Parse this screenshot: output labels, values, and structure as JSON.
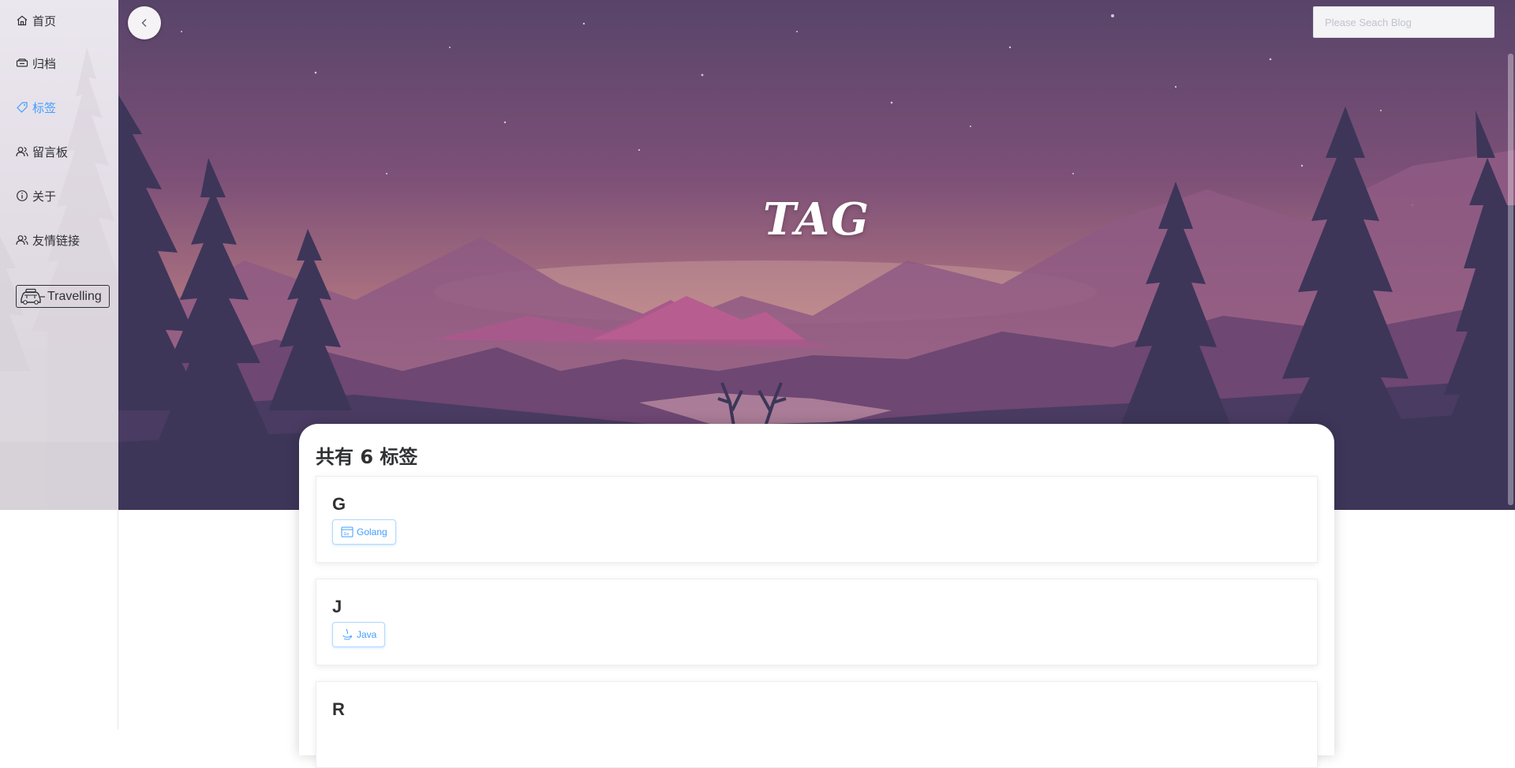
{
  "sidebar": {
    "items": [
      {
        "label": "首页",
        "icon": "home-icon"
      },
      {
        "label": "归档",
        "icon": "archive-icon"
      },
      {
        "label": "标签",
        "icon": "tag-icon",
        "active": true
      },
      {
        "label": "留言板",
        "icon": "users-icon"
      },
      {
        "label": "关于",
        "icon": "info-icon"
      },
      {
        "label": "友情链接",
        "icon": "users-icon"
      }
    ],
    "travel_label": "Travelling"
  },
  "header": {
    "search_placeholder": "Please Seach Blog",
    "hero_title": "TAG"
  },
  "main": {
    "summary": "共有 6 标签",
    "groups": [
      {
        "letter": "G",
        "tag": "Golang",
        "icon": "golang-icon"
      },
      {
        "letter": "J",
        "tag": "Java",
        "icon": "java-icon"
      },
      {
        "letter": "R",
        "tag": "",
        "icon": ""
      }
    ]
  },
  "colors": {
    "accent": "#409eff",
    "text": "#303133",
    "sky_top": "#5a4670",
    "sky_mid": "#8e5a7e",
    "horizon": "#c89a8c",
    "forest": "#3d3659"
  }
}
